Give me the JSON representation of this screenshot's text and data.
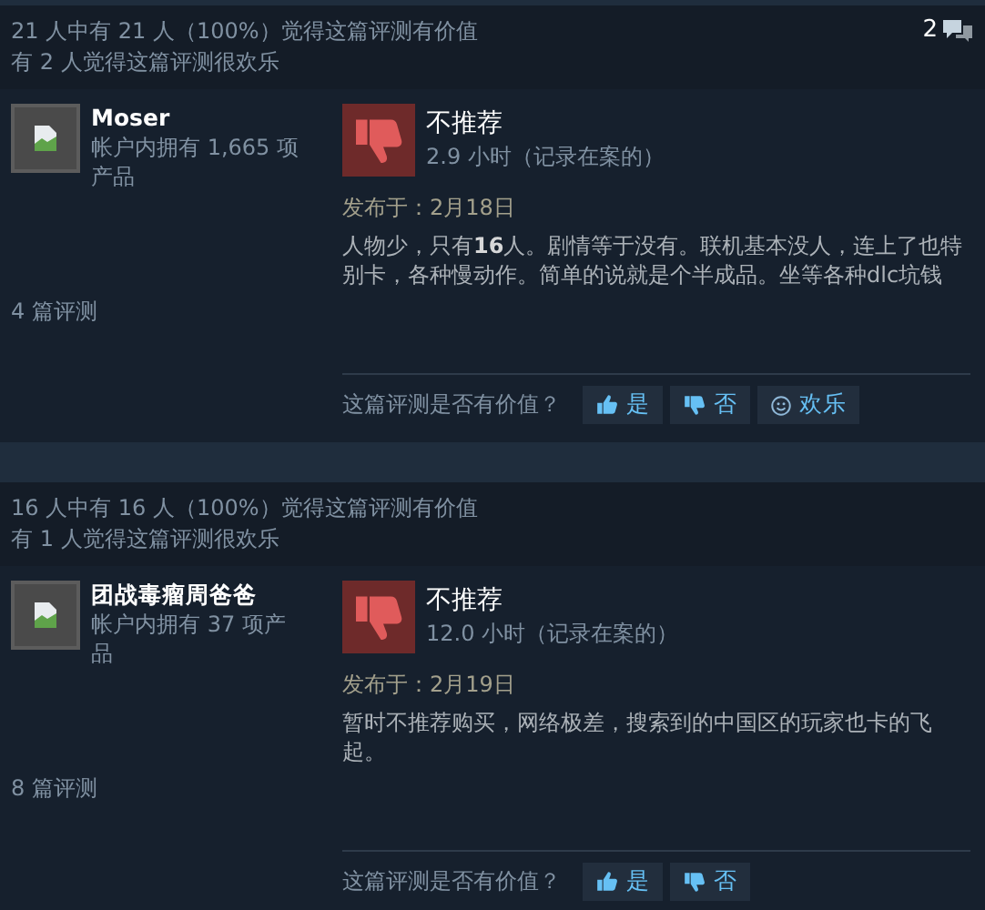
{
  "reviews": [
    {
      "helpful_text": "21 人中有 21 人（100%）觉得这篇评测有价值",
      "funny_text": "有 2 人觉得这篇评测很欢乐",
      "comment_count": "2",
      "author": {
        "name": "Moser",
        "products": "帐户内拥有 1,665 项产品",
        "reviews_count": "4 篇评测"
      },
      "recommended": false,
      "verdict": "不推荐",
      "hours": "2.9 小时（记录在案的）",
      "posted": "发布于：2月18日",
      "body": "人物少，只有**16**人。剧情等于没有。联机基本没人，连上了也特别卡，各种慢动作。简单的说就是个半成品。坐等各种dlc坑钱",
      "vote_prompt": "这篇评测是否有价值？",
      "vote_buttons": [
        {
          "kind": "yes",
          "label": "是"
        },
        {
          "kind": "no",
          "label": "否"
        },
        {
          "kind": "funny",
          "label": "欢乐"
        }
      ]
    },
    {
      "helpful_text": "16 人中有 16 人（100%）觉得这篇评测有价值",
      "funny_text": "有 1 人觉得这篇评测很欢乐",
      "author": {
        "name": "团战毒瘤周爸爸",
        "products": "帐户内拥有 37 项产品",
        "reviews_count": "8 篇评测"
      },
      "recommended": false,
      "verdict": "不推荐",
      "hours": "12.0 小时（记录在案的）",
      "posted": "发布于：2月19日",
      "body": "暂时不推荐购买，网络极差，搜索到的中国区的玩家也卡的飞起。",
      "vote_prompt": "这篇评测是否有价值？",
      "vote_buttons": [
        {
          "kind": "yes",
          "label": "是"
        },
        {
          "kind": "no",
          "label": "否"
        }
      ]
    }
  ]
}
